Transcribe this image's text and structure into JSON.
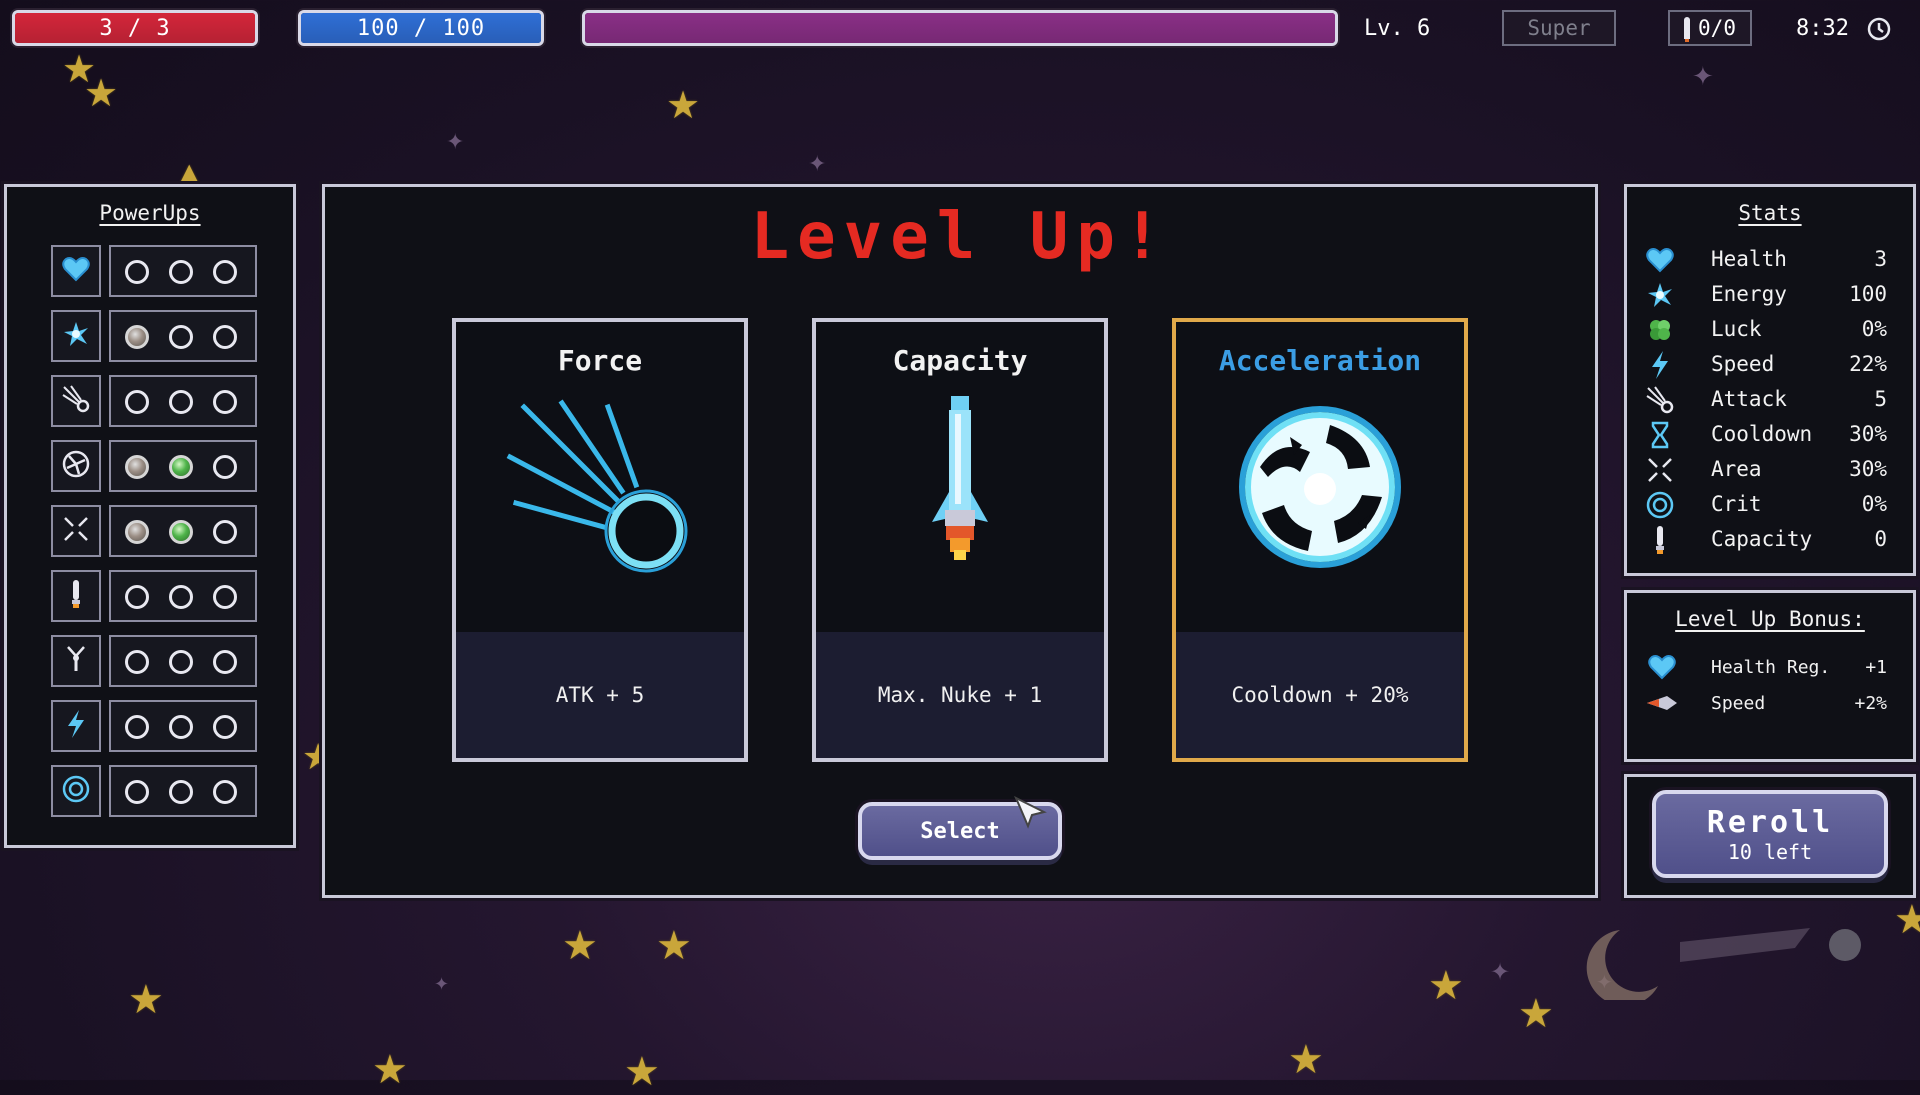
{
  "hud": {
    "health_text": "3 / 3",
    "energy_text": "100 / 100",
    "health_fraction": 1.0,
    "energy_fraction": 1.0,
    "xp_fraction": 1.0,
    "level_text": "Lv. 6",
    "super_label": "Super",
    "nuke_text": "0/0",
    "timer": "8:32",
    "colors": {
      "health": "#d4263a",
      "energy": "#2f6fd6",
      "xp": "#8a2f86"
    }
  },
  "powerups": {
    "title": "PowerUps",
    "rows": [
      {
        "icon": "heart-icon",
        "slots": [
          "empty",
          "empty",
          "empty"
        ]
      },
      {
        "icon": "energy-burst-icon",
        "slots": [
          "gray",
          "empty",
          "empty"
        ]
      },
      {
        "icon": "comet-icon",
        "slots": [
          "empty",
          "empty",
          "empty"
        ]
      },
      {
        "icon": "vortex-icon",
        "slots": [
          "gray",
          "green",
          "empty"
        ]
      },
      {
        "icon": "area-arrows-icon",
        "slots": [
          "gray",
          "green",
          "empty"
        ]
      },
      {
        "icon": "nuke-icon",
        "slots": [
          "empty",
          "empty",
          "empty"
        ]
      },
      {
        "icon": "magnet-icon",
        "slots": [
          "empty",
          "empty",
          "empty"
        ]
      },
      {
        "icon": "lightning-icon",
        "slots": [
          "empty",
          "empty",
          "empty"
        ]
      },
      {
        "icon": "crosshair-icon",
        "slots": [
          "empty",
          "empty",
          "empty"
        ]
      }
    ]
  },
  "levelup": {
    "title": "Level Up!",
    "cards": [
      {
        "title": "Force",
        "effect": "ATK + 5",
        "icon": "comet-icon",
        "selected": false
      },
      {
        "title": "Capacity",
        "effect": "Max. Nuke + 1",
        "icon": "rocket-icon",
        "selected": false
      },
      {
        "title": "Acceleration",
        "effect": "Cooldown + 20%",
        "icon": "vortex-icon",
        "selected": true
      }
    ],
    "select_label": "Select"
  },
  "stats": {
    "title": "Stats",
    "rows": [
      {
        "icon": "heart-icon",
        "name": "Health",
        "value": "3"
      },
      {
        "icon": "energy-burst-icon",
        "name": "Energy",
        "value": "100"
      },
      {
        "icon": "clover-icon",
        "name": "Luck",
        "value": "0%"
      },
      {
        "icon": "lightning-icon",
        "name": "Speed",
        "value": "22%"
      },
      {
        "icon": "comet-icon",
        "name": "Attack",
        "value": "5"
      },
      {
        "icon": "hourglass-icon",
        "name": "Cooldown",
        "value": "30%"
      },
      {
        "icon": "area-arrows-icon",
        "name": "Area",
        "value": "30%"
      },
      {
        "icon": "crosshair-icon",
        "name": "Crit",
        "value": "0%"
      },
      {
        "icon": "nuke-icon",
        "name": "Capacity",
        "value": "0"
      }
    ]
  },
  "bonus": {
    "title": "Level Up Bonus:",
    "rows": [
      {
        "icon": "heart-icon",
        "name": "Health Reg.",
        "value": "+1"
      },
      {
        "icon": "ship-icon",
        "name": "Speed",
        "value": "+2%"
      }
    ]
  },
  "reroll": {
    "label": "Reroll",
    "sublabel": "10 left"
  }
}
